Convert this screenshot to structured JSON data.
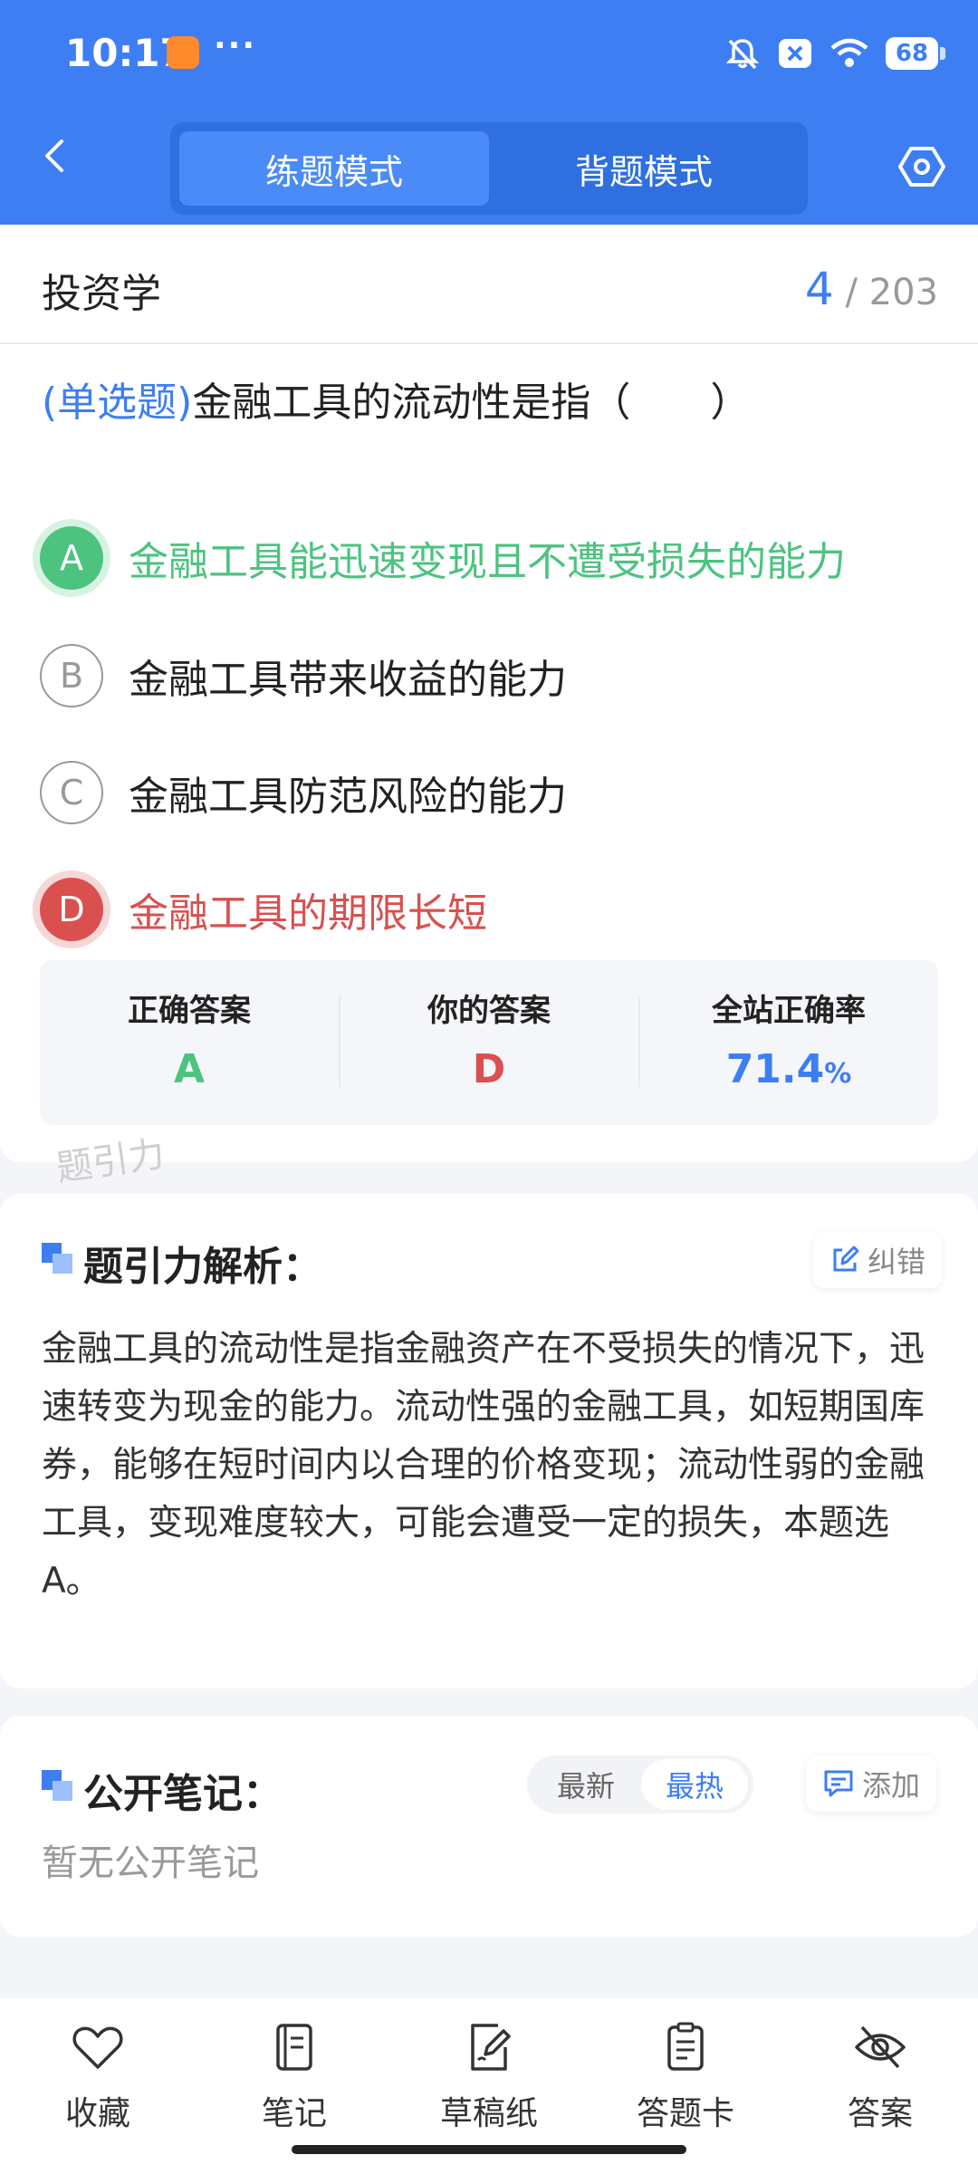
{
  "status_bar": {
    "time": "10:17",
    "battery": "68"
  },
  "header": {
    "tabs": [
      {
        "label": "练题模式",
        "active": true
      },
      {
        "label": "背题模式",
        "active": false
      }
    ]
  },
  "question": {
    "subject": "投资学",
    "progress_current": "4",
    "progress_total": "/ 203",
    "type_label": "(单选题)",
    "text": "金融工具的流动性是指（　　）",
    "options": [
      {
        "letter": "A",
        "text": "金融工具能迅速变现且不遭受损失的能力",
        "state": "correct"
      },
      {
        "letter": "B",
        "text": "金融工具带来收益的能力",
        "state": "normal"
      },
      {
        "letter": "C",
        "text": "金融工具防范风险的能力",
        "state": "normal"
      },
      {
        "letter": "D",
        "text": "金融工具的期限长短",
        "state": "wrong"
      }
    ],
    "result": {
      "correct_label": "正确答案",
      "correct_value": "A",
      "yours_label": "你的答案",
      "yours_value": "D",
      "rate_label": "全站正确率",
      "rate_value": "71.4",
      "rate_unit": "%"
    },
    "watermark": "题引力"
  },
  "analysis": {
    "title": "题引力解析：",
    "report_label": "纠错",
    "text": "金融工具的流动性是指金融资产在不受损失的情况下，迅速转变为现金的能力。流动性强的金融工具，如短期国库券，能够在短时间内以合理的价格变现；流动性弱的金融工具，变现难度较大，可能会遭受一定的损失，本题选 A。"
  },
  "notes": {
    "title": "公开笔记：",
    "sort_newest": "最新",
    "sort_hottest": "最热",
    "add_label": "添加",
    "empty_text": "暂无公开笔记"
  },
  "bottom_nav": [
    {
      "label": "收藏",
      "icon": "heart-icon"
    },
    {
      "label": "笔记",
      "icon": "notebook-icon"
    },
    {
      "label": "草稿纸",
      "icon": "draft-paper-icon"
    },
    {
      "label": "答题卡",
      "icon": "answer-sheet-icon"
    },
    {
      "label": "答案",
      "icon": "eye-hidden-icon"
    }
  ],
  "colors": {
    "primary": "#3d7ef3",
    "correct": "#4cc37f",
    "wrong": "#d9504f"
  }
}
